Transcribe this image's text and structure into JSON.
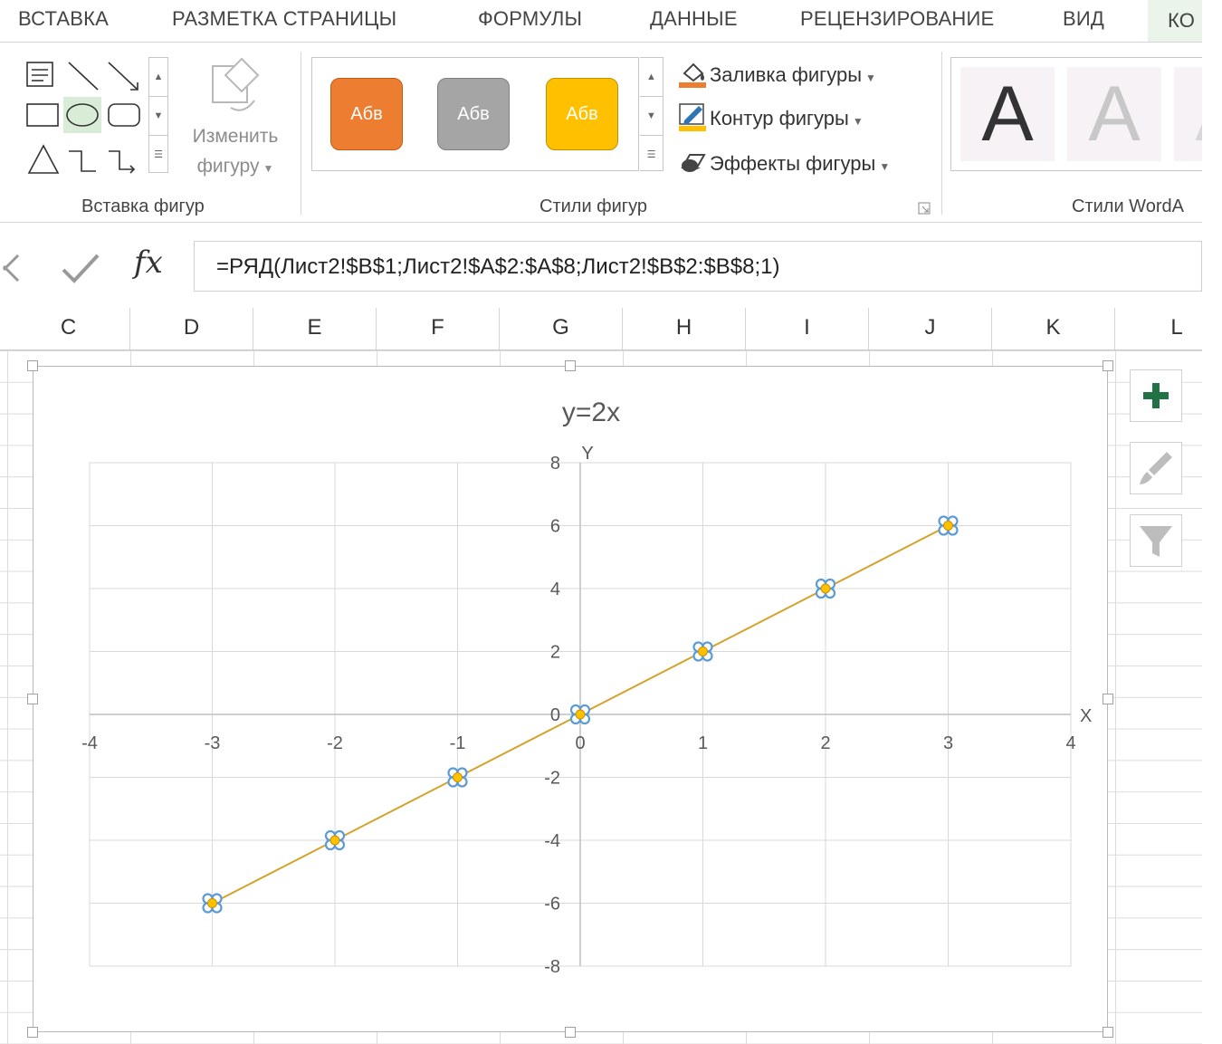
{
  "ribbon": {
    "tabs": [
      "ВСТАВКА",
      "РАЗМЕТКА СТРАНИЦЫ",
      "ФОРМУЛЫ",
      "ДАННЫЕ",
      "РЕЦЕНЗИРОВАНИЕ",
      "ВИД",
      "КО"
    ],
    "insert_shapes": {
      "label": "Вставка фигур",
      "change_shape_line1": "Изменить",
      "change_shape_line2": "фигуру"
    },
    "shape_styles": {
      "label": "Стили фигур",
      "presets": [
        {
          "text": "Абв",
          "fill": "#ed7d31",
          "border": "#c55a11"
        },
        {
          "text": "Абв",
          "fill": "#a5a5a5",
          "border": "#7f7f7f"
        },
        {
          "text": "Абв",
          "fill": "#ffc000",
          "border": "#bf9000"
        }
      ],
      "fill_label": "Заливка фигуры",
      "outline_label": "Контур фигуры",
      "effects_label": "Эффекты фигуры"
    },
    "wordart": {
      "label": "Стили WordA",
      "letter": "A"
    }
  },
  "formula_bar": {
    "formula": "=РЯД(Лист2!$B$1;Лист2!$A$2:$A$8;Лист2!$B$2:$B$8;1)",
    "fx": "fx"
  },
  "columns": [
    "C",
    "D",
    "E",
    "F",
    "G",
    "H",
    "I",
    "J",
    "K",
    "L"
  ],
  "colors": {
    "line": "#d4a32c",
    "marker": "#ffc000",
    "marker_border": "#5b9bd5",
    "accent_green": "#217346"
  },
  "chart_data": {
    "type": "scatter",
    "title": "y=2x",
    "xlabel": "X",
    "ylabel": "Y",
    "x": [
      -3,
      -2,
      -1,
      0,
      1,
      2,
      3
    ],
    "y": [
      -6,
      -4,
      -2,
      0,
      2,
      4,
      6
    ],
    "xlim": [
      -4,
      4
    ],
    "ylim": [
      -8,
      8
    ],
    "xticks": [
      -4,
      -3,
      -2,
      -1,
      0,
      1,
      2,
      3,
      4
    ],
    "yticks": [
      -8,
      -6,
      -4,
      -2,
      0,
      2,
      4,
      6,
      8
    ],
    "grid": true,
    "legend": "none"
  }
}
